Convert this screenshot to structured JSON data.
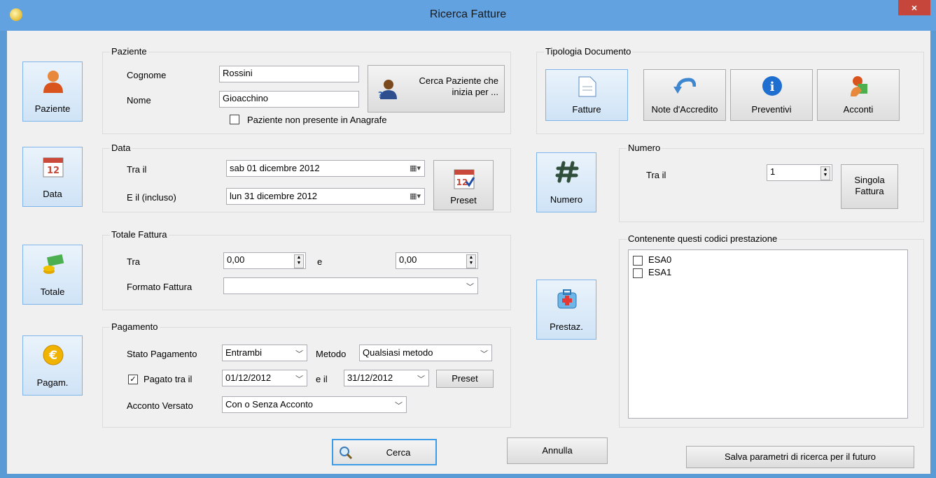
{
  "window": {
    "title": "Ricerca Fatture",
    "close_glyph": "×"
  },
  "sidebar": [
    {
      "label": "Paziente",
      "icon": "person-icon"
    },
    {
      "label": "Data",
      "icon": "calendar-icon"
    },
    {
      "label": "Totale",
      "icon": "money-icon"
    },
    {
      "label": "Pagam.",
      "icon": "euro-coin-icon"
    }
  ],
  "paziente": {
    "group_label": "Paziente",
    "cognome_label": "Cognome",
    "cognome_value": "Rossini",
    "nome_label": "Nome",
    "nome_value": "Gioacchino",
    "search_button": "Cerca Paziente che inizia per ...",
    "not_present_label": "Paziente non presente in Anagrafe",
    "not_present_checked": false
  },
  "data": {
    "group_label": "Data",
    "from_label": "Tra il",
    "from_value": "sab 01 dicembre 2012",
    "to_label": "E il (incluso)",
    "to_value": "lun 31 dicembre 2012",
    "preset_label": "Preset"
  },
  "totale": {
    "group_label": "Totale Fattura",
    "tra_label": "Tra",
    "min_value": "0,00",
    "e_label": "e",
    "max_value": "0,00",
    "formato_label": "Formato Fattura",
    "formato_value": ""
  },
  "pagamento": {
    "group_label": "Pagamento",
    "stato_label": "Stato Pagamento",
    "stato_value": "Entrambi",
    "metodo_label": "Metodo",
    "metodo_value": "Qualsiasi metodo",
    "pagato_label": "Pagato tra il",
    "pagato_checked": true,
    "pagato_from": "01/12/2012",
    "eil_label": "e il",
    "pagato_to": "31/12/2012",
    "preset_label": "Preset",
    "acconto_label": "Acconto Versato",
    "acconto_value": "Con o Senza Acconto"
  },
  "middle": {
    "numero_button": "Numero",
    "prestaz_button": "Prestaz."
  },
  "tipologia": {
    "group_label": "Tipologia Documento",
    "buttons": [
      {
        "label": "Fatture",
        "icon": "document-icon",
        "active": true
      },
      {
        "label": "Note d'Accredito",
        "icon": "undo-arrow-icon",
        "active": false
      },
      {
        "label": "Preventivi",
        "icon": "info-icon",
        "active": false
      },
      {
        "label": "Acconti",
        "icon": "hand-money-icon",
        "active": false
      }
    ]
  },
  "numero": {
    "group_label": "Numero",
    "tra_label": "Tra il",
    "value": "1",
    "singola_button": "Singola Fattura"
  },
  "codici": {
    "group_label": "Contenente questi codici prestazione",
    "items": [
      {
        "code": "ESA0",
        "checked": false
      },
      {
        "code": "ESA1",
        "checked": false
      }
    ]
  },
  "footer": {
    "cerca": "Cerca",
    "annulla": "Annulla",
    "salva": "Salva parametri di ricerca per il futuro"
  }
}
